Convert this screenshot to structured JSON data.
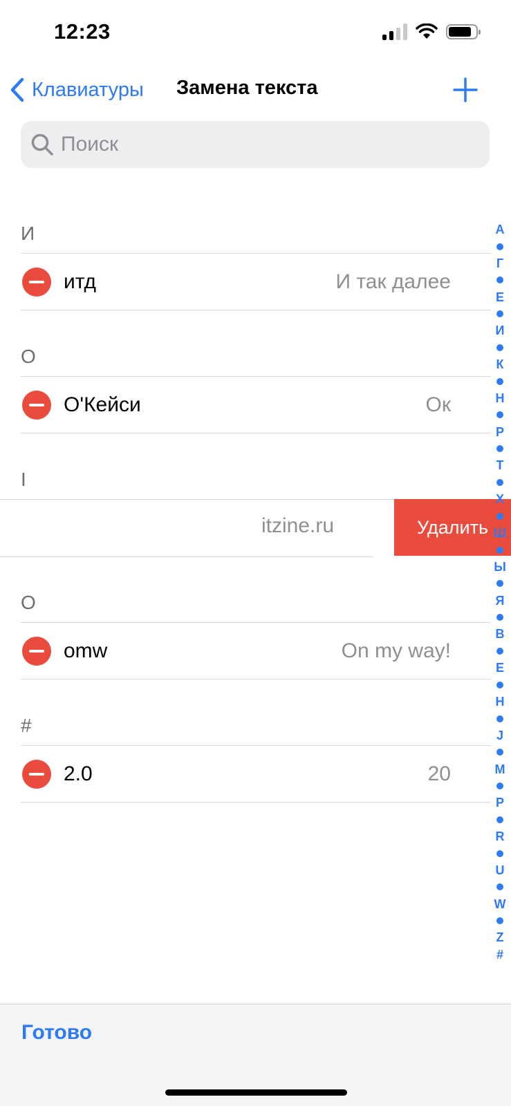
{
  "status_bar": {
    "time": "12:23",
    "signal_icon": "cellular-signal-icon",
    "wifi_icon": "wifi-icon",
    "battery_icon": "battery-icon"
  },
  "nav": {
    "back_label": "Клавиатуры",
    "title": "Замена текста",
    "add_icon": "plus-icon"
  },
  "search": {
    "placeholder": "Поиск",
    "value": ""
  },
  "sections": [
    {
      "header": "И",
      "rows": [
        {
          "shortcut": "итд",
          "phrase": "И так далее"
        }
      ]
    },
    {
      "header": "О",
      "rows": [
        {
          "shortcut": "О'Кейси",
          "phrase": "Ок"
        }
      ]
    },
    {
      "header": "I",
      "rows": [
        {
          "shortcut": "",
          "phrase": "itzine.ru"
        }
      ]
    },
    {
      "header": "O",
      "rows": [
        {
          "shortcut": "omw",
          "phrase": "On my way!"
        }
      ]
    },
    {
      "header": "#",
      "rows": [
        {
          "shortcut": "2.0",
          "phrase": "20"
        }
      ]
    }
  ],
  "swipe_action": {
    "delete_label": "Удалить"
  },
  "section_index": [
    "А",
    "•",
    "Г",
    "•",
    "Е",
    "•",
    "И",
    "•",
    "К",
    "•",
    "Н",
    "•",
    "Р",
    "•",
    "Т",
    "•",
    "Х",
    "•",
    "Ш",
    "•",
    "Ы",
    "•",
    "Я",
    "•",
    "B",
    "•",
    "E",
    "•",
    "H",
    "•",
    "J",
    "•",
    "M",
    "•",
    "P",
    "•",
    "R",
    "•",
    "U",
    "•",
    "W",
    "•",
    "Z",
    "#"
  ],
  "toolbar": {
    "done_label": "Готово"
  },
  "colors": {
    "accent": "#2d7af5",
    "destructive": "#e94c3d",
    "secondary_text": "#8e8e93"
  }
}
